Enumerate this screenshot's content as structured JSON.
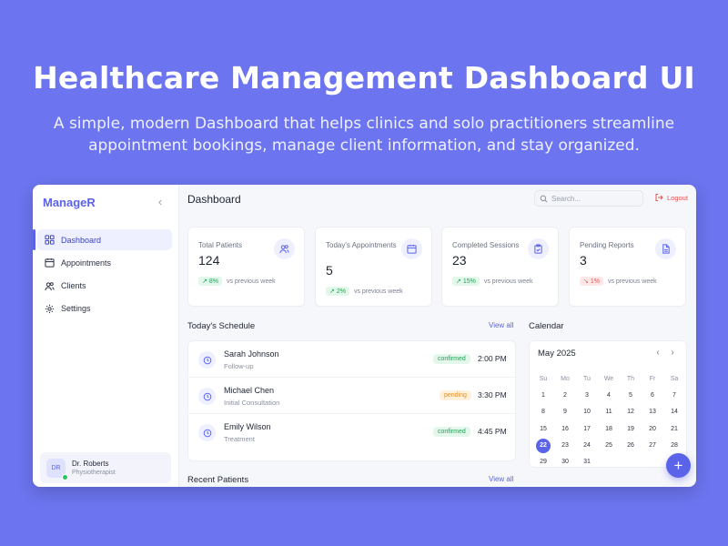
{
  "hero": {
    "title": "Healthcare Management Dashboard UI",
    "subtitle_line1": "A simple, modern Dashboard that helps clinics and solo practitioners streamline",
    "subtitle_line2": "appointment bookings, manage client information, and stay organized."
  },
  "sidebar": {
    "brand": "ManageR",
    "collapse_icon": "chevron-left-icon",
    "items": [
      {
        "label": "Dashboard",
        "icon": "grid-icon",
        "active": true
      },
      {
        "label": "Appointments",
        "icon": "calendar-icon",
        "active": false
      },
      {
        "label": "Clients",
        "icon": "users-icon",
        "active": false
      },
      {
        "label": "Settings",
        "icon": "gear-icon",
        "active": false
      }
    ],
    "profile": {
      "initials": "DR",
      "name": "Dr. Roberts",
      "role": "Physiotherapist"
    }
  },
  "header": {
    "title": "Dashboard",
    "search_placeholder": "Search...",
    "logout_label": "Logout"
  },
  "stats": [
    {
      "label": "Total Patients",
      "value": "124",
      "trend": "8%",
      "direction": "up",
      "note": "vs previous week",
      "icon": "users-icon"
    },
    {
      "label": "Today's Appointments",
      "value": "5",
      "trend": "2%",
      "direction": "up",
      "note": "vs previous week",
      "icon": "calendar-icon"
    },
    {
      "label": "Completed Sessions",
      "value": "23",
      "trend": "15%",
      "direction": "up",
      "note": "vs previous week",
      "icon": "clipboard-check-icon"
    },
    {
      "label": "Pending Reports",
      "value": "3",
      "trend": "1%",
      "direction": "down",
      "note": "vs previous week",
      "icon": "file-icon"
    }
  ],
  "schedule": {
    "title": "Today's Schedule",
    "view_all": "View all",
    "items": [
      {
        "name": "Sarah Johnson",
        "type": "Follow-up",
        "status": "confirmed",
        "time": "2:00 PM"
      },
      {
        "name": "Michael Chen",
        "type": "Initial Consultation",
        "status": "pending",
        "time": "3:30 PM"
      },
      {
        "name": "Emily Wilson",
        "type": "Treatment",
        "status": "confirmed",
        "time": "4:45 PM"
      }
    ]
  },
  "calendar": {
    "title": "Calendar",
    "month": "May 2025",
    "weekdays": [
      "Su",
      "Mo",
      "Tu",
      "We",
      "Th",
      "Fr",
      "Sa"
    ],
    "weeks": [
      [
        "1",
        "2",
        "3",
        "4",
        "5",
        "6",
        "7"
      ],
      [
        "8",
        "9",
        "10",
        "11",
        "12",
        "13",
        "14"
      ],
      [
        "15",
        "16",
        "17",
        "18",
        "19",
        "20",
        "21"
      ],
      [
        "22",
        "23",
        "24",
        "25",
        "26",
        "27",
        "28"
      ],
      [
        "29",
        "30",
        "31",
        "",
        "",
        "",
        ""
      ]
    ],
    "today": "22"
  },
  "recent": {
    "title": "Recent Patients",
    "view_all": "View all"
  },
  "fab": {
    "label": "+"
  },
  "colors": {
    "background": "#6c74ef",
    "accent": "#5b63e8",
    "success": "#1ea356",
    "warning": "#e0902b",
    "danger": "#e25454"
  }
}
